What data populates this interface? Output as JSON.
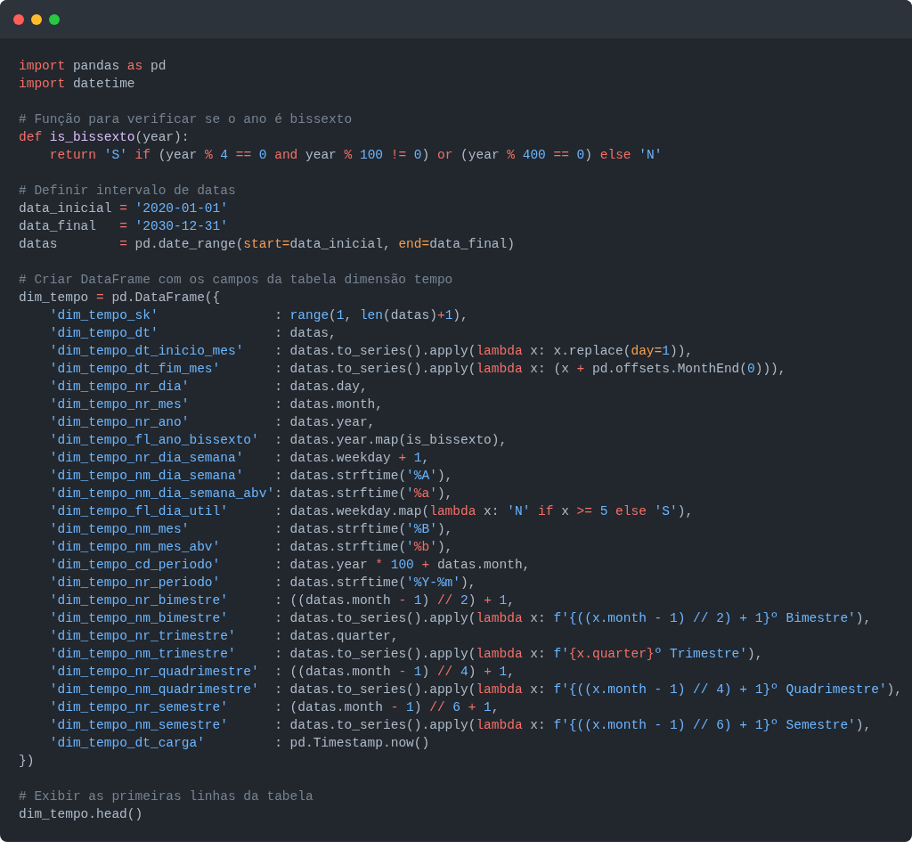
{
  "window_controls": [
    {
      "color": "#ff5f57"
    },
    {
      "color": "#febc2e"
    },
    {
      "color": "#28c840"
    }
  ],
  "code_blocks": [
    [
      [
        {
          "kind": "keyword",
          "text": "import"
        },
        {
          "kind": "plain",
          "text": " pandas "
        },
        {
          "kind": "keyword",
          "text": "as"
        },
        {
          "kind": "plain",
          "text": " pd"
        }
      ],
      [
        {
          "kind": "keyword",
          "text": "import"
        },
        {
          "kind": "plain",
          "text": " datetime"
        }
      ]
    ],
    [
      [
        {
          "kind": "comment",
          "text": "# Função para verificar se o ano é bissexto"
        }
      ],
      [
        {
          "kind": "keyword",
          "text": "def"
        },
        {
          "kind": "function",
          "text": " is_bissexto"
        },
        {
          "kind": "plain",
          "text": "(year):"
        }
      ],
      [
        {
          "kind": "keyword",
          "text": "    return"
        },
        {
          "kind": "string",
          "text": " 'S'"
        },
        {
          "kind": "keyword",
          "text": " if"
        },
        {
          "kind": "plain",
          "text": " (year "
        },
        {
          "kind": "keyword",
          "text": "%"
        },
        {
          "kind": "number",
          "text": " 4"
        },
        {
          "kind": "keyword",
          "text": " =="
        },
        {
          "kind": "number",
          "text": " 0"
        },
        {
          "kind": "keyword",
          "text": " and"
        },
        {
          "kind": "plain",
          "text": " year "
        },
        {
          "kind": "keyword",
          "text": "%"
        },
        {
          "kind": "number",
          "text": " 100"
        },
        {
          "kind": "keyword",
          "text": " !="
        },
        {
          "kind": "number",
          "text": " 0"
        },
        {
          "kind": "plain",
          "text": ") "
        },
        {
          "kind": "keyword",
          "text": "or"
        },
        {
          "kind": "plain",
          "text": " (year "
        },
        {
          "kind": "keyword",
          "text": "%"
        },
        {
          "kind": "number",
          "text": " 400"
        },
        {
          "kind": "keyword",
          "text": " =="
        },
        {
          "kind": "number",
          "text": " 0"
        },
        {
          "kind": "plain",
          "text": ") "
        },
        {
          "kind": "keyword",
          "text": "else"
        },
        {
          "kind": "string",
          "text": " 'N'"
        }
      ]
    ],
    [
      [
        {
          "kind": "comment",
          "text": "# Definir intervalo de datas"
        }
      ],
      [
        {
          "kind": "plain",
          "text": "data_inicial "
        },
        {
          "kind": "keyword",
          "text": "="
        },
        {
          "kind": "string",
          "text": " '2020-01-01'"
        }
      ],
      [
        {
          "kind": "plain",
          "text": "data_final   "
        },
        {
          "kind": "keyword",
          "text": "="
        },
        {
          "kind": "string",
          "text": " '2030-12-31'"
        }
      ],
      [
        {
          "kind": "plain",
          "text": "datas        "
        },
        {
          "kind": "keyword",
          "text": "="
        },
        {
          "kind": "plain",
          "text": " pd.date_range("
        },
        {
          "kind": "argument",
          "text": "start="
        },
        {
          "kind": "plain",
          "text": "data_inicial, "
        },
        {
          "kind": "argument",
          "text": "end="
        },
        {
          "kind": "plain",
          "text": "data_final)"
        }
      ]
    ],
    [
      [
        {
          "kind": "comment",
          "text": "# Criar DataFrame com os campos da tabela dimensão tempo"
        }
      ],
      [
        {
          "kind": "plain",
          "text": "dim_tempo "
        },
        {
          "kind": "keyword",
          "text": "="
        },
        {
          "kind": "plain",
          "text": " pd.DataFrame({"
        }
      ],
      [
        {
          "kind": "string",
          "text": "    'dim_tempo_sk'"
        },
        {
          "kind": "plain",
          "text": "               : "
        },
        {
          "kind": "builtin",
          "text": "range"
        },
        {
          "kind": "plain",
          "text": "("
        },
        {
          "kind": "number",
          "text": "1"
        },
        {
          "kind": "plain",
          "text": ", "
        },
        {
          "kind": "builtin",
          "text": "len"
        },
        {
          "kind": "plain",
          "text": "(datas)"
        },
        {
          "kind": "keyword",
          "text": "+"
        },
        {
          "kind": "number",
          "text": "1"
        },
        {
          "kind": "plain",
          "text": "),"
        }
      ],
      [
        {
          "kind": "string",
          "text": "    'dim_tempo_dt'"
        },
        {
          "kind": "plain",
          "text": "               : datas,"
        }
      ],
      [
        {
          "kind": "string",
          "text": "    'dim_tempo_dt_inicio_mes'"
        },
        {
          "kind": "plain",
          "text": "    : datas.to_series().apply("
        },
        {
          "kind": "keyword",
          "text": "lambda"
        },
        {
          "kind": "plain",
          "text": " x: x.replace("
        },
        {
          "kind": "argument",
          "text": "day="
        },
        {
          "kind": "number",
          "text": "1"
        },
        {
          "kind": "plain",
          "text": ")),"
        }
      ],
      [
        {
          "kind": "string",
          "text": "    'dim_tempo_dt_fim_mes'"
        },
        {
          "kind": "plain",
          "text": "       : datas.to_series().apply("
        },
        {
          "kind": "keyword",
          "text": "lambda"
        },
        {
          "kind": "plain",
          "text": " x: (x "
        },
        {
          "kind": "keyword",
          "text": "+"
        },
        {
          "kind": "plain",
          "text": " pd.offsets.MonthEnd("
        },
        {
          "kind": "number",
          "text": "0"
        },
        {
          "kind": "plain",
          "text": "))),"
        }
      ],
      [
        {
          "kind": "string",
          "text": "    'dim_tempo_nr_dia'"
        },
        {
          "kind": "plain",
          "text": "           : datas.day,"
        }
      ],
      [
        {
          "kind": "string",
          "text": "    'dim_tempo_nr_mes'"
        },
        {
          "kind": "plain",
          "text": "           : datas.month,"
        }
      ],
      [
        {
          "kind": "string",
          "text": "    'dim_tempo_nr_ano'"
        },
        {
          "kind": "plain",
          "text": "           : datas.year,"
        }
      ],
      [
        {
          "kind": "string",
          "text": "    'dim_tempo_fl_ano_bissexto'"
        },
        {
          "kind": "plain",
          "text": "  : datas.year.map(is_bissexto),"
        }
      ],
      [
        {
          "kind": "string",
          "text": "    'dim_tempo_nr_dia_semana'"
        },
        {
          "kind": "plain",
          "text": "    : datas.weekday "
        },
        {
          "kind": "keyword",
          "text": "+"
        },
        {
          "kind": "number",
          "text": " 1"
        },
        {
          "kind": "plain",
          "text": ","
        }
      ],
      [
        {
          "kind": "string",
          "text": "    'dim_tempo_nm_dia_semana'"
        },
        {
          "kind": "plain",
          "text": "    : datas.strftime("
        },
        {
          "kind": "string",
          "text": "'%A'"
        },
        {
          "kind": "plain",
          "text": "),"
        }
      ],
      [
        {
          "kind": "string",
          "text": "    'dim_tempo_nm_dia_semana_abv'"
        },
        {
          "kind": "plain",
          "text": ": datas.strftime("
        },
        {
          "kind": "string",
          "text": "'"
        },
        {
          "kind": "keyword",
          "text": "%a"
        },
        {
          "kind": "string",
          "text": "'"
        },
        {
          "kind": "plain",
          "text": "),"
        }
      ],
      [
        {
          "kind": "string",
          "text": "    'dim_tempo_fl_dia_util'"
        },
        {
          "kind": "plain",
          "text": "      : datas.weekday.map("
        },
        {
          "kind": "keyword",
          "text": "lambda"
        },
        {
          "kind": "plain",
          "text": " x: "
        },
        {
          "kind": "string",
          "text": "'N'"
        },
        {
          "kind": "keyword",
          "text": " if"
        },
        {
          "kind": "plain",
          "text": " x "
        },
        {
          "kind": "keyword",
          "text": ">="
        },
        {
          "kind": "number",
          "text": " 5"
        },
        {
          "kind": "keyword",
          "text": " else"
        },
        {
          "kind": "string",
          "text": " 'S'"
        },
        {
          "kind": "plain",
          "text": "),"
        }
      ],
      [
        {
          "kind": "string",
          "text": "    'dim_tempo_nm_mes'"
        },
        {
          "kind": "plain",
          "text": "           : datas.strftime("
        },
        {
          "kind": "string",
          "text": "'%B'"
        },
        {
          "kind": "plain",
          "text": "),"
        }
      ],
      [
        {
          "kind": "string",
          "text": "    'dim_tempo_nm_mes_abv'"
        },
        {
          "kind": "plain",
          "text": "       : datas.strftime("
        },
        {
          "kind": "string",
          "text": "'"
        },
        {
          "kind": "keyword",
          "text": "%b"
        },
        {
          "kind": "string",
          "text": "'"
        },
        {
          "kind": "plain",
          "text": "),"
        }
      ],
      [
        {
          "kind": "string",
          "text": "    'dim_tempo_cd_periodo'"
        },
        {
          "kind": "plain",
          "text": "       : datas.year "
        },
        {
          "kind": "keyword",
          "text": "*"
        },
        {
          "kind": "number",
          "text": " 100"
        },
        {
          "kind": "keyword",
          "text": " +"
        },
        {
          "kind": "plain",
          "text": " datas.month,"
        }
      ],
      [
        {
          "kind": "string",
          "text": "    'dim_tempo_nr_periodo'"
        },
        {
          "kind": "plain",
          "text": "       : datas.strftime("
        },
        {
          "kind": "string",
          "text": "'%Y-%m'"
        },
        {
          "kind": "plain",
          "text": "),"
        }
      ],
      [
        {
          "kind": "string",
          "text": "    'dim_tempo_nr_bimestre'"
        },
        {
          "kind": "plain",
          "text": "      : ((datas.month "
        },
        {
          "kind": "keyword",
          "text": "-"
        },
        {
          "kind": "number",
          "text": " 1"
        },
        {
          "kind": "plain",
          "text": ") "
        },
        {
          "kind": "keyword",
          "text": "//"
        },
        {
          "kind": "number",
          "text": " 2"
        },
        {
          "kind": "plain",
          "text": ") "
        },
        {
          "kind": "keyword",
          "text": "+"
        },
        {
          "kind": "number",
          "text": " 1"
        },
        {
          "kind": "plain",
          "text": ","
        }
      ],
      [
        {
          "kind": "string",
          "text": "    'dim_tempo_nm_bimestre'"
        },
        {
          "kind": "plain",
          "text": "      : datas.to_series().apply("
        },
        {
          "kind": "keyword",
          "text": "lambda"
        },
        {
          "kind": "plain",
          "text": " x: "
        },
        {
          "kind": "string",
          "text": "f'{((x.month - 1) // 2) + 1}º Bimestre'"
        },
        {
          "kind": "plain",
          "text": "),"
        }
      ],
      [
        {
          "kind": "string",
          "text": "    'dim_tempo_nr_trimestre'"
        },
        {
          "kind": "plain",
          "text": "     : datas.quarter,"
        }
      ],
      [
        {
          "kind": "string",
          "text": "    'dim_tempo_nm_trimestre'"
        },
        {
          "kind": "plain",
          "text": "     : datas.to_series().apply("
        },
        {
          "kind": "keyword",
          "text": "lambda"
        },
        {
          "kind": "plain",
          "text": " x: "
        },
        {
          "kind": "string",
          "text": "f'"
        },
        {
          "kind": "keyword",
          "text": "{x.quarter}"
        },
        {
          "kind": "string",
          "text": "º Trimestre'"
        },
        {
          "kind": "plain",
          "text": "),"
        }
      ],
      [
        {
          "kind": "string",
          "text": "    'dim_tempo_nr_quadrimestre'"
        },
        {
          "kind": "plain",
          "text": "  : ((datas.month "
        },
        {
          "kind": "keyword",
          "text": "-"
        },
        {
          "kind": "number",
          "text": " 1"
        },
        {
          "kind": "plain",
          "text": ") "
        },
        {
          "kind": "keyword",
          "text": "//"
        },
        {
          "kind": "number",
          "text": " 4"
        },
        {
          "kind": "plain",
          "text": ") "
        },
        {
          "kind": "keyword",
          "text": "+"
        },
        {
          "kind": "number",
          "text": " 1"
        },
        {
          "kind": "plain",
          "text": ","
        }
      ],
      [
        {
          "kind": "string",
          "text": "    'dim_tempo_nm_quadrimestre'"
        },
        {
          "kind": "plain",
          "text": "  : datas.to_series().apply("
        },
        {
          "kind": "keyword",
          "text": "lambda"
        },
        {
          "kind": "plain",
          "text": " x: "
        },
        {
          "kind": "string",
          "text": "f'{((x.month - 1) // 4) + 1}º Quadrimestre'"
        },
        {
          "kind": "plain",
          "text": "),"
        }
      ],
      [
        {
          "kind": "string",
          "text": "    'dim_tempo_nr_semestre'"
        },
        {
          "kind": "plain",
          "text": "      : (datas.month "
        },
        {
          "kind": "keyword",
          "text": "-"
        },
        {
          "kind": "number",
          "text": " 1"
        },
        {
          "kind": "plain",
          "text": ") "
        },
        {
          "kind": "keyword",
          "text": "//"
        },
        {
          "kind": "number",
          "text": " 6"
        },
        {
          "kind": "keyword",
          "text": " +"
        },
        {
          "kind": "number",
          "text": " 1"
        },
        {
          "kind": "plain",
          "text": ","
        }
      ],
      [
        {
          "kind": "string",
          "text": "    'dim_tempo_nm_semestre'"
        },
        {
          "kind": "plain",
          "text": "      : datas.to_series().apply("
        },
        {
          "kind": "keyword",
          "text": "lambda"
        },
        {
          "kind": "plain",
          "text": " x: "
        },
        {
          "kind": "string",
          "text": "f'{((x.month - 1) // 6) + 1}º Semestre'"
        },
        {
          "kind": "plain",
          "text": "),"
        }
      ],
      [
        {
          "kind": "string",
          "text": "    'dim_tempo_dt_carga'"
        },
        {
          "kind": "plain",
          "text": "         : pd.Timestamp.now()"
        }
      ],
      [
        {
          "kind": "plain",
          "text": "})"
        }
      ]
    ],
    [
      [
        {
          "kind": "comment",
          "text": "# Exibir as primeiras linhas da tabela"
        }
      ],
      [
        {
          "kind": "plain",
          "text": "dim_tempo.head()"
        }
      ]
    ]
  ]
}
